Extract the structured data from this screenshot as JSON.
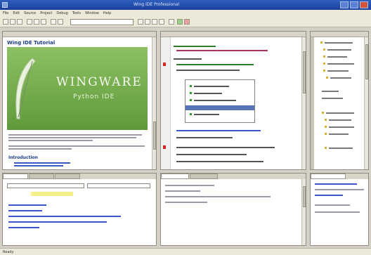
{
  "window": {
    "title": "Wing IDE Professional"
  },
  "menu": [
    "File",
    "Edit",
    "Source",
    "Project",
    "Debug",
    "Tools",
    "Window",
    "Help"
  ],
  "doc": {
    "title": "Wing IDE Tutorial",
    "banner_word": "WINGWARE",
    "banner_sub": "Python IDE",
    "section": "Introduction"
  },
  "statusbar": {
    "text": "Ready"
  },
  "colors": {
    "accent": "#1b3f9a",
    "banner": "#6fa84a",
    "link": "#3a58c8"
  },
  "icons": [
    "app-icon",
    "minimize-icon",
    "maximize-icon",
    "close-icon",
    "feather-icon"
  ]
}
